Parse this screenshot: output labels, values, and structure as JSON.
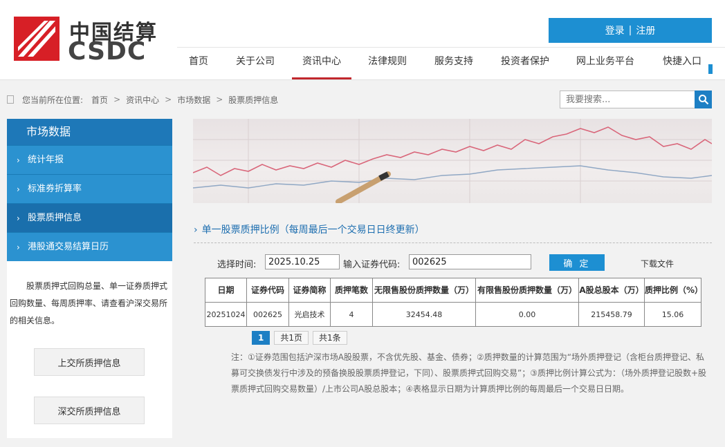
{
  "header": {
    "logo_cn": "中国结算",
    "logo_en": "CSDC",
    "login": "登录",
    "divider": "|",
    "register": "注册"
  },
  "nav": {
    "items": [
      {
        "label": "首页"
      },
      {
        "label": "关于公司"
      },
      {
        "label": "资讯中心"
      },
      {
        "label": "法律规则"
      },
      {
        "label": "服务支持"
      },
      {
        "label": "投资者保护"
      },
      {
        "label": "网上业务平台"
      },
      {
        "label": "快捷入口"
      }
    ],
    "active": "资讯中心"
  },
  "breadcrumb": {
    "prefix": "您当前所在位置:",
    "items": [
      "首页",
      "资讯中心",
      "市场数据",
      "股票质押信息"
    ],
    "separator": ">"
  },
  "search": {
    "placeholder": "我要搜索..."
  },
  "sidebar": {
    "title": "市场数据",
    "items": [
      {
        "label": "统计年报"
      },
      {
        "label": "标准券折算率"
      },
      {
        "label": "股票质押信息"
      },
      {
        "label": "港股通交易结算日历"
      }
    ],
    "active": "股票质押信息",
    "description": "股票质押式回购总量、单一证券质押式回购数量、每周质押率、请查看沪深交易所的相关信息。",
    "buttons": [
      {
        "label": "上交所质押信息"
      },
      {
        "label": "深交所质押信息"
      }
    ]
  },
  "main": {
    "section_title": "单一股票质押比例（每周最后一个交易日日终更新）",
    "query": {
      "time_label": "选择时间:",
      "time_value": "2025.10.25",
      "code_label": "输入证券代码:",
      "code_value": "002625",
      "confirm": "确 定",
      "download": "下载文件"
    },
    "table": {
      "headers": [
        "日期",
        "证券代码",
        "证券简称",
        "质押笔数",
        "无限售股份质押数量（万）",
        "有限售股份质押数量（万）",
        "A股总股本（万）",
        "质押比例（%）"
      ],
      "rows": [
        [
          "20251024",
          "002625",
          "光启技术",
          "4",
          "32454.48",
          "0.00",
          "215458.79",
          "15.06"
        ]
      ]
    },
    "pager": {
      "current": "1",
      "total_pages": "共1页",
      "total_rows": "共1条"
    },
    "note": "注：①证券范围包括沪深市场A股股票，不含优先股、基金、债券；②质押数量的计算范围为“场外质押登记（含柜台质押登记、私募可交换债发行中涉及的预备换股股票质押登记，下同）、股票质押式回购交易”；③质押比例计算公式为：（场外质押登记股数+股票质押式回购交易数量）/上市公司A股总股本；④表格显示日期为计算质押比例的每周最后一个交易日日期。"
  },
  "colors": {
    "brand_blue": "#1d8fd2",
    "brand_red": "#c1272d",
    "sidebar_blue": "#2b92d0"
  }
}
